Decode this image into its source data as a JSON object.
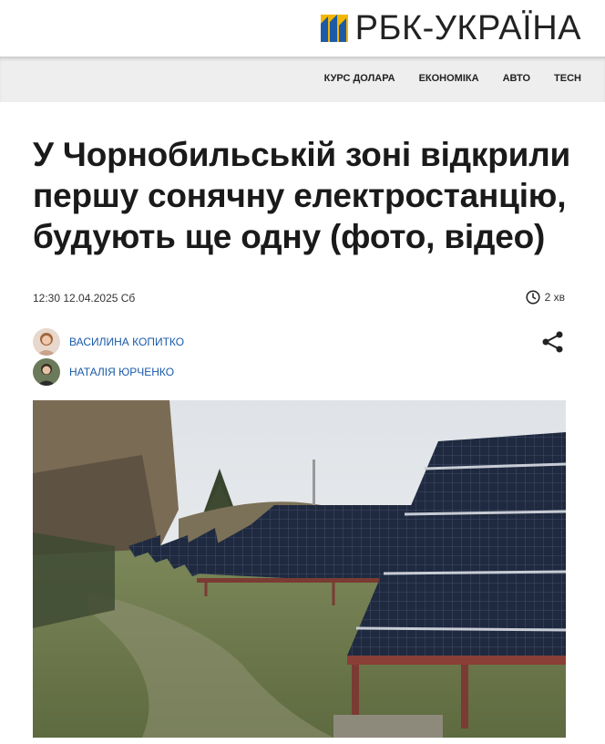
{
  "brand": {
    "logo_text": "РБК-УКРАЇНА",
    "accent": "#1d5aa6",
    "accent2": "#f2b705"
  },
  "nav": {
    "items": [
      "КУРС ДОЛАРА",
      "ЕКОНОМІКА",
      "АВТО",
      "TECH"
    ]
  },
  "article": {
    "title": "У Чорнобильській зоні відкрили першу сонячну електростанцію, будують ще одну (фото, відео)",
    "datetime": "12:30 12.04.2025 Сб",
    "read_time": "2 хв",
    "authors": [
      {
        "name": "ВАСИЛИНА КОПИТКО"
      },
      {
        "name": "НАТАЛІЯ ЮРЧЕНКО"
      }
    ],
    "share_icon": "share-icon",
    "clock_icon": "clock-icon"
  }
}
